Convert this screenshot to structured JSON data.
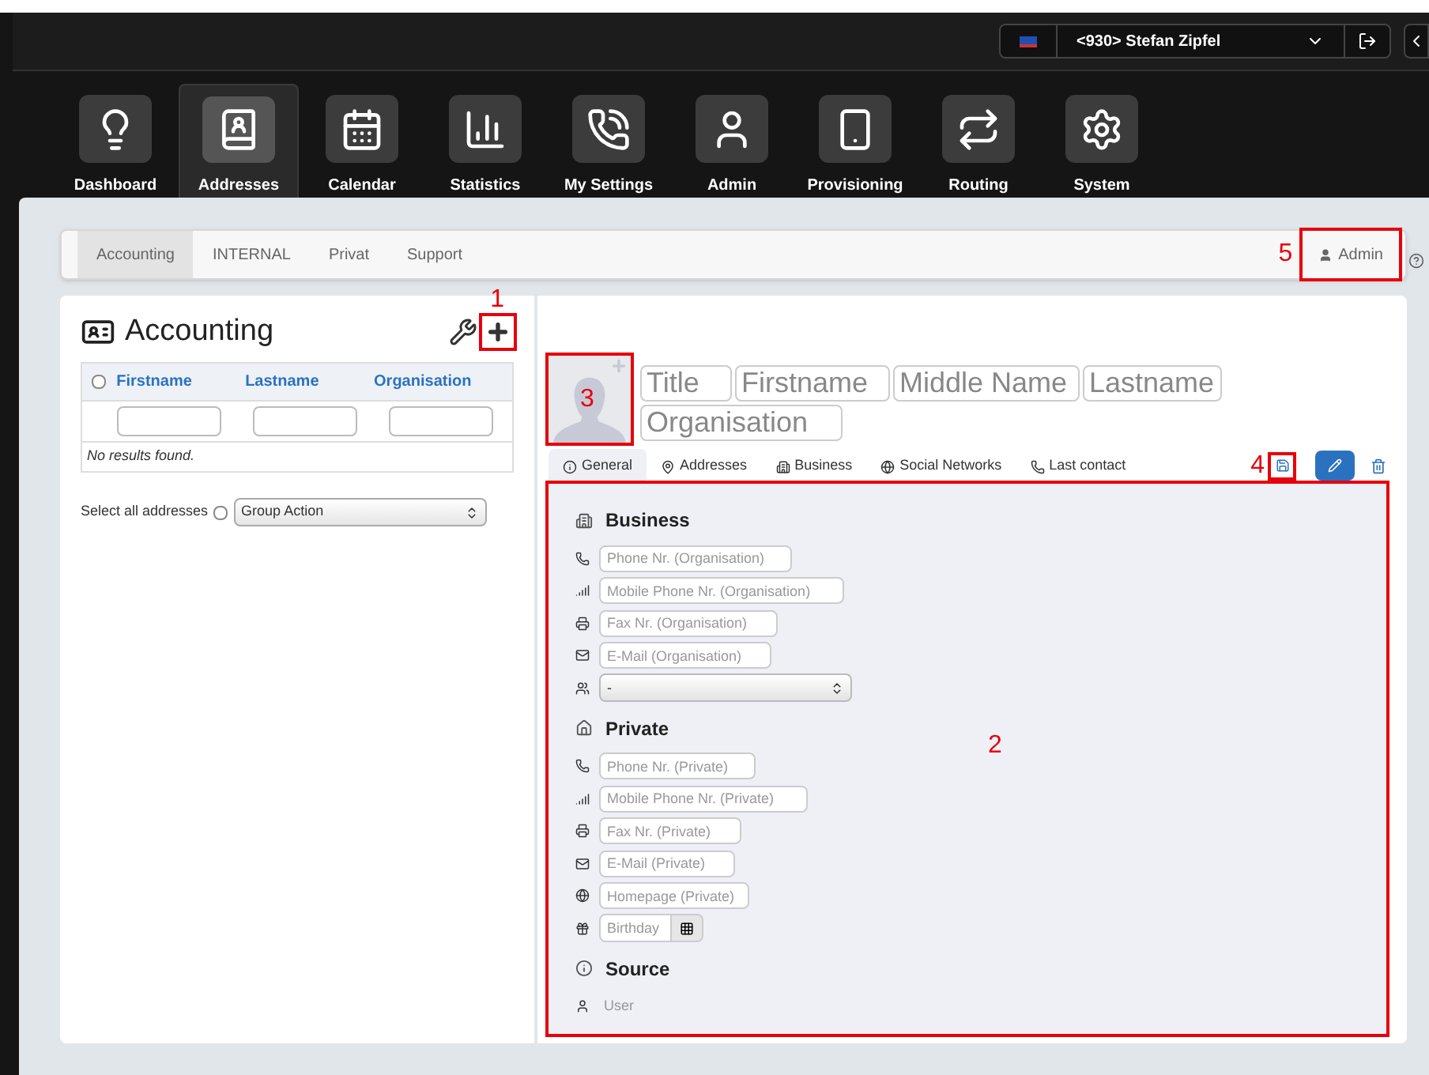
{
  "top_bar": {
    "user_select": {
      "value": "<930> Stefan Zipfel"
    }
  },
  "nav": [
    {
      "label": "Dashboard",
      "selected": false
    },
    {
      "label": "Addresses",
      "selected": true
    },
    {
      "label": "Calendar",
      "selected": false
    },
    {
      "label": "Statistics",
      "selected": false
    },
    {
      "label": "My Settings",
      "selected": false
    },
    {
      "label": "Admin",
      "selected": false
    },
    {
      "label": "Provisioning",
      "selected": false
    },
    {
      "label": "Routing",
      "selected": false
    },
    {
      "label": "System",
      "selected": false
    }
  ],
  "group_tabs": [
    {
      "label": "Accounting",
      "selected": true
    },
    {
      "label": "INTERNAL",
      "selected": false
    },
    {
      "label": "Privat",
      "selected": false
    },
    {
      "label": "Support",
      "selected": false
    }
  ],
  "admin_button": {
    "label": "Admin",
    "callout": "5"
  },
  "list_panel": {
    "title": "Accounting",
    "add_callout": "1",
    "columns": [
      "Firstname",
      "Lastname",
      "Organisation"
    ],
    "header_checked": false,
    "empty": "No results found.",
    "select_all": {
      "label": "Select all addresses",
      "checked": false
    },
    "group_action": "Group Action"
  },
  "contact": {
    "photo_callout": "3",
    "name_fields": [
      {
        "placeholder": "Title"
      },
      {
        "placeholder": "Firstname"
      },
      {
        "placeholder": "Middle Name"
      },
      {
        "placeholder": "Lastname"
      },
      {
        "placeholder": "Organisation"
      }
    ],
    "tabs": [
      {
        "label": "General",
        "selected": true
      },
      {
        "label": "Addresses",
        "selected": false
      },
      {
        "label": "Business",
        "selected": false
      },
      {
        "label": "Social Networks",
        "selected": false
      },
      {
        "label": "Last contact",
        "selected": false
      }
    ],
    "save_callout": "4",
    "form_callout": "2",
    "sections": [
      {
        "title": "Business",
        "fields": [
          {
            "kind": "input",
            "placeholder": "Phone Nr. (Organisation)"
          },
          {
            "kind": "input",
            "placeholder": "Mobile Phone Nr. (Organisation)"
          },
          {
            "kind": "input",
            "placeholder": "Fax Nr. (Organisation)"
          },
          {
            "kind": "input",
            "placeholder": "E-Mail (Organisation)"
          },
          {
            "kind": "select",
            "value": "-"
          }
        ]
      },
      {
        "title": "Private",
        "fields": [
          {
            "kind": "input",
            "placeholder": "Phone Nr. (Private)"
          },
          {
            "kind": "input",
            "placeholder": "Mobile Phone Nr. (Private)"
          },
          {
            "kind": "input",
            "placeholder": "Fax Nr. (Private)"
          },
          {
            "kind": "input",
            "placeholder": "E-Mail (Private)"
          },
          {
            "kind": "input",
            "placeholder": "Homepage (Private)"
          },
          {
            "kind": "date",
            "placeholder": "Birthday"
          }
        ]
      },
      {
        "title": "Source",
        "fields": [
          {
            "kind": "text",
            "value": "User"
          }
        ]
      }
    ]
  }
}
